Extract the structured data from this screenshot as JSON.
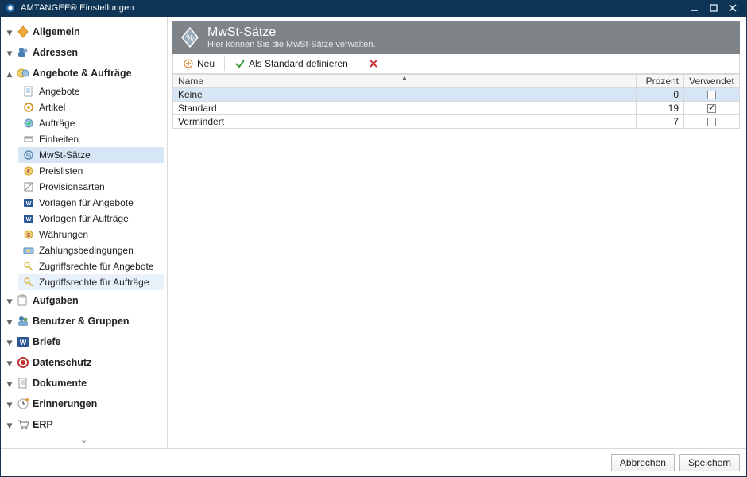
{
  "window": {
    "title": "AMTANGEE® Einstellungen"
  },
  "sidebar": {
    "allgemein": {
      "label": "Allgemein"
    },
    "adressen": {
      "label": "Adressen"
    },
    "angebote": {
      "label": "Angebote & Aufträge",
      "items": {
        "angebote": "Angebote",
        "artikel": "Artikel",
        "auftraege": "Aufträge",
        "einheiten": "Einheiten",
        "mwst": "MwSt-Sätze",
        "preislisten": "Preislisten",
        "provisionsarten": "Provisionsarten",
        "vorlagen_angebote": "Vorlagen für Angebote",
        "vorlagen_auftraege": "Vorlagen für Aufträge",
        "waehrungen": "Währungen",
        "zahlungsbedingungen": "Zahlungsbedingungen",
        "zugriff_angebote": "Zugriffsrechte für Angebote",
        "zugriff_auftraege": "Zugriffsrechte für Aufträge"
      }
    },
    "aufgaben": {
      "label": "Aufgaben"
    },
    "benutzer": {
      "label": "Benutzer & Gruppen"
    },
    "briefe": {
      "label": "Briefe"
    },
    "datenschutz": {
      "label": "Datenschutz"
    },
    "dokumente": {
      "label": "Dokumente"
    },
    "erinnerungen": {
      "label": "Erinnerungen"
    },
    "erp": {
      "label": "ERP"
    }
  },
  "panel": {
    "title": "MwSt-Sätze",
    "subtitle": "Hier können Sie die MwSt-Sätze verwalten."
  },
  "toolbar": {
    "neu": "Neu",
    "als_standard": "Als Standard definieren"
  },
  "grid": {
    "headers": {
      "name": "Name",
      "prozent": "Prozent",
      "verwendet": "Verwendet"
    },
    "rows": [
      {
        "name": "Keine",
        "prozent": "0",
        "verwendet": false,
        "selected": true
      },
      {
        "name": "Standard",
        "prozent": "19",
        "verwendet": true,
        "selected": false
      },
      {
        "name": "Vermindert",
        "prozent": "7",
        "verwendet": false,
        "selected": false
      }
    ]
  },
  "footer": {
    "abbrechen": "Abbrechen",
    "speichern": "Speichern"
  }
}
